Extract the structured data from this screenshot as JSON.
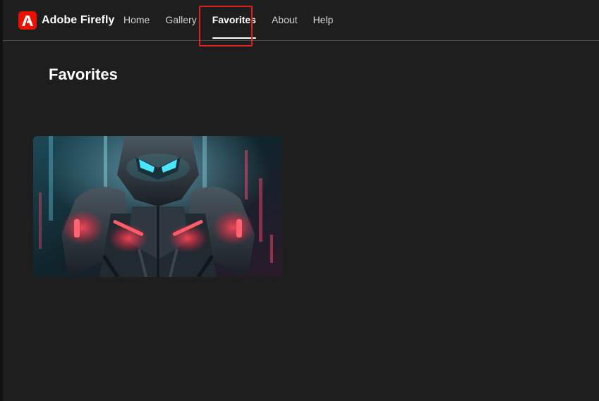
{
  "brand": {
    "name": "Adobe Firefly",
    "logo_icon": "adobe-logo-icon",
    "color": "#eb1000"
  },
  "nav": {
    "items": [
      {
        "label": "Home"
      },
      {
        "label": "Gallery"
      },
      {
        "label": "Favorites",
        "active": true
      },
      {
        "label": "About"
      },
      {
        "label": "Help"
      }
    ]
  },
  "page": {
    "title": "Favorites"
  },
  "favorites": [
    {
      "image": "cyberpunk-armored-robot-image"
    }
  ],
  "colors": {
    "background": "#1e1e1e",
    "accent_highlight": "#e0201c",
    "text": "#ffffff"
  }
}
